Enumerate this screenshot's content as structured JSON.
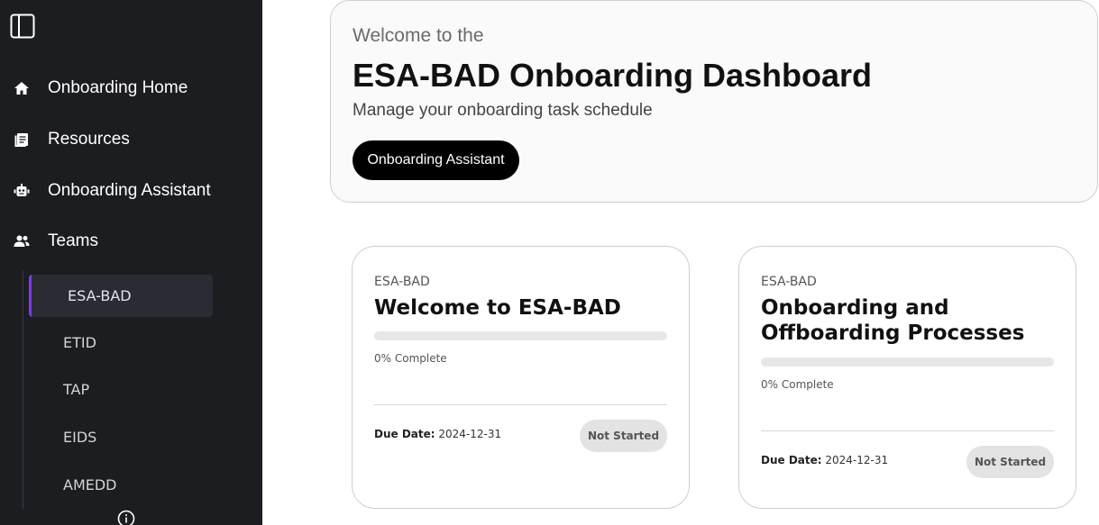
{
  "sidebar": {
    "nav": [
      {
        "label": "Onboarding Home",
        "icon": "home-icon"
      },
      {
        "label": "Resources",
        "icon": "resources-icon"
      },
      {
        "label": "Onboarding Assistant",
        "icon": "robot-icon"
      },
      {
        "label": "Teams",
        "icon": "people-icon"
      }
    ],
    "teams": [
      {
        "label": "ESA-BAD",
        "active": true
      },
      {
        "label": "ETID",
        "active": false
      },
      {
        "label": "TAP",
        "active": false
      },
      {
        "label": "EIDS",
        "active": false
      },
      {
        "label": "AMEDD",
        "active": false
      }
    ]
  },
  "hero": {
    "intro": "Welcome to the",
    "title": "ESA-BAD Onboarding Dashboard",
    "subtitle": "Manage your onboarding task schedule",
    "button_label": "Onboarding Assistant"
  },
  "cards": [
    {
      "team": "ESA-BAD",
      "title": "Welcome to ESA-BAD",
      "progress": 0,
      "progress_text": "0% Complete",
      "due_label": "Due Date:",
      "due_value": "2024-12-31",
      "status": "Not Started"
    },
    {
      "team": "ESA-BAD",
      "title": "Onboarding and Offboarding Processes",
      "progress": 0,
      "progress_text": "0% Complete",
      "due_label": "Due Date:",
      "due_value": "2024-12-31",
      "status": "Not Started"
    }
  ],
  "colors": {
    "sidebar_bg": "#1c1d21",
    "accent": "#7c3aed",
    "badge_bg": "#e3e3e3"
  }
}
